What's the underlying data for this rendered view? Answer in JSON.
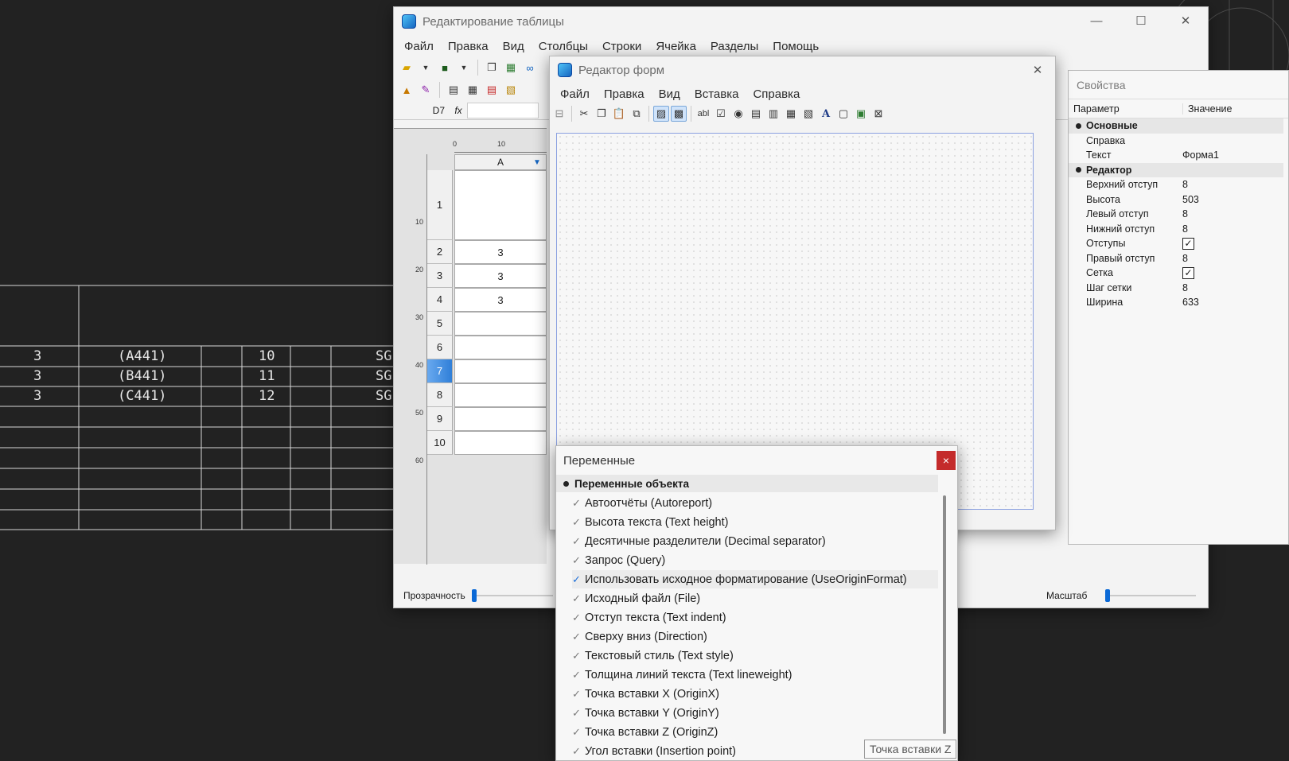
{
  "cad": {
    "rows": [
      {
        "c1": "3",
        "c2": "(A441)",
        "c3": "10",
        "c4": "SG"
      },
      {
        "c1": "3",
        "c2": "(B441)",
        "c3": "11",
        "c4": "SG"
      },
      {
        "c1": "3",
        "c2": "(C441)",
        "c3": "12",
        "c4": "SG"
      }
    ]
  },
  "table_window": {
    "title": "Редактирование таблицы",
    "menu": [
      "Файл",
      "Правка",
      "Вид",
      "Столбцы",
      "Строки",
      "Ячейка",
      "Разделы",
      "Помощь"
    ],
    "cell_ref": "D7",
    "fx": "fx",
    "ruler_h": [
      "0",
      "10"
    ],
    "ruler_v": [
      "10",
      "20",
      "30",
      "40",
      "50",
      "60"
    ],
    "column_header": "A",
    "rows": [
      {
        "num": "1",
        "value": ""
      },
      {
        "num": "2",
        "value": "3"
      },
      {
        "num": "3",
        "value": "3"
      },
      {
        "num": "4",
        "value": "3"
      },
      {
        "num": "5",
        "value": ""
      },
      {
        "num": "6",
        "value": ""
      },
      {
        "num": "7",
        "value": ""
      },
      {
        "num": "8",
        "value": ""
      },
      {
        "num": "9",
        "value": ""
      },
      {
        "num": "10",
        "value": ""
      }
    ],
    "selected_row": "7",
    "transparency_label": "Прозрачность",
    "scale_label": "Масштаб",
    "transparency_level": 0,
    "scale_level": 0
  },
  "form_editor": {
    "title": "Редактор форм",
    "menu": [
      "Файл",
      "Правка",
      "Вид",
      "Вставка",
      "Справка"
    ]
  },
  "properties": {
    "title": "Свойства",
    "col_param": "Параметр",
    "col_value": "Значение",
    "rows": [
      {
        "type": "cat",
        "name": "Основные"
      },
      {
        "type": "prop",
        "name": "Справка",
        "value": ""
      },
      {
        "type": "prop",
        "name": "Текст",
        "value": "Форма1"
      },
      {
        "type": "cat",
        "name": "Редактор"
      },
      {
        "type": "prop",
        "name": "Верхний отступ",
        "value": "8"
      },
      {
        "type": "prop",
        "name": "Высота",
        "value": "503"
      },
      {
        "type": "prop",
        "name": "Левый отступ",
        "value": "8"
      },
      {
        "type": "prop",
        "name": "Нижний отступ",
        "value": "8"
      },
      {
        "type": "check",
        "name": "Отступы",
        "value": "✓"
      },
      {
        "type": "prop",
        "name": "Правый отступ",
        "value": "8"
      },
      {
        "type": "check",
        "name": "Сетка",
        "value": "✓"
      },
      {
        "type": "prop",
        "name": "Шаг сетки",
        "value": "8"
      },
      {
        "type": "prop",
        "name": "Ширина",
        "value": "633"
      }
    ]
  },
  "variables": {
    "title": "Переменные",
    "close": "×",
    "group": "Переменные объекта",
    "items": [
      "Автоотчёты (Autoreport)",
      "Высота текста (Text height)",
      "Десятичные разделители (Decimal separator)",
      "Запрос (Query)",
      "Использовать исходное форматирование (UseOriginFormat)",
      "Исходный файл (File)",
      "Отступ текста (Text indent)",
      "Сверху вниз (Direction)",
      "Текстовый стиль (Text style)",
      "Толщина линий текста (Text lineweight)",
      "Точка вставки X (OriginX)",
      "Точка вставки Y (OriginY)",
      "Точка вставки Z (OriginZ)",
      "Угол вставки (Insertion point)"
    ],
    "highlighted_index": 4,
    "tooltip": "Точка вставки Z"
  }
}
